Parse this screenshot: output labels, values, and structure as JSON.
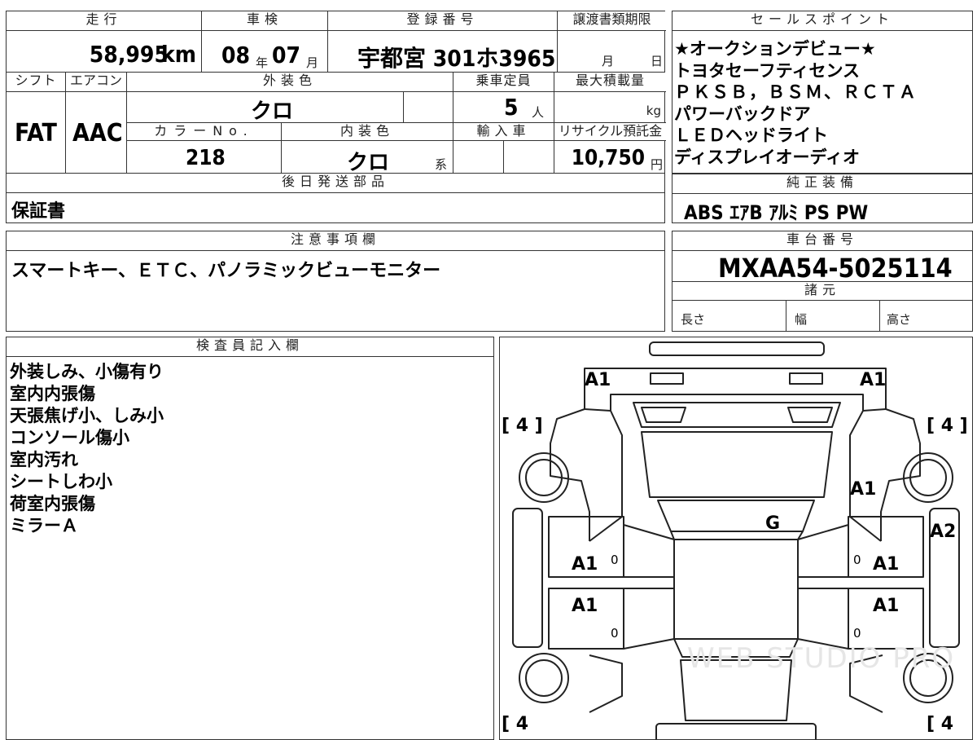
{
  "header": {
    "mileage_label": "走行",
    "inspection_label": "車検",
    "registration_label": "登録番号",
    "transfer_deadline_label": "譲渡書類期限",
    "sales_point_label": "セールスポイント"
  },
  "vehicle": {
    "mileage": "58,995",
    "mileage_unit": "km",
    "inspection_year": "08",
    "year_unit": "年",
    "inspection_month": "07",
    "month_unit": "月",
    "registration": "宇都宮 301ホ3965",
    "deadline_month_unit": "月",
    "deadline_day_unit": "日"
  },
  "row2": {
    "shift_label": "シフト",
    "ac_label": "エアコン",
    "exterior_color_label": "外装色",
    "capacity_label": "乗車定員",
    "max_load_label": "最大積載量",
    "shift": "FAT",
    "ac": "AAC",
    "exterior_color": "クロ",
    "capacity": "5",
    "capacity_unit": "人",
    "max_load_unit": "kg",
    "color_no_label": "カラーNo.",
    "interior_color_label": "内装色",
    "import_label": "輸入車",
    "recycle_label": "リサイクル預託金",
    "color_no": "218",
    "interior_color": "クロ",
    "interior_suffix": "系",
    "recycle_fee": "10,750",
    "recycle_unit": "円"
  },
  "later_parts": {
    "label": "後日発送部品",
    "value": "保証書"
  },
  "sales_points": [
    "★オークションデビュー★",
    "トヨタセーフティセンス",
    "ＰＫＳＢ，ＢＳＭ、ＲＣＴＡ",
    "パワーバックドア",
    "ＬＥＤヘッドライト",
    "ディスプレイオーディオ"
  ],
  "standard_equipment": {
    "label": "純正装備",
    "value": "ABS ｴｱB ｱﾙﾐ PS PW"
  },
  "notes": {
    "label": "注意事項欄",
    "value": "スマートキー、ＥＴＣ、パノラミックビューモニター"
  },
  "chassis": {
    "label": "車台番号",
    "value": "MXAA54-5025114"
  },
  "specs": {
    "label": "諸元",
    "length_label": "長さ",
    "width_label": "幅",
    "height_label": "高さ"
  },
  "inspector": {
    "label": "検査員記入欄",
    "lines": [
      "外装しみ、小傷有り",
      "室内内張傷",
      "天張焦げ小、しみ小",
      "コンソール傷小",
      "室内汚れ",
      "シートしわ小",
      "荷室内張傷",
      "ミラーＡ"
    ]
  },
  "diagram": {
    "marks": {
      "front_left": "A1",
      "front_right": "A1",
      "hood_right": "A1",
      "roof": "G",
      "right_side": "A2",
      "front_door_left": "A1",
      "front_door_right": "A1",
      "rear_door_left": "A1",
      "rear_door_right": "A1"
    },
    "tire_tl": "[ 4 ]",
    "tire_tr": "[ 4 ]",
    "tire_bl": "[ 4",
    "tire_br": "[ 4",
    "zero": "0",
    "watermark": "WEB STUDIO PRO"
  }
}
